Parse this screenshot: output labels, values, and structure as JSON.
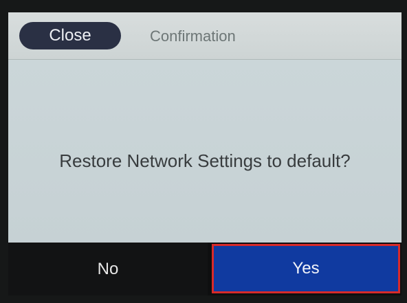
{
  "header": {
    "close_label": "Close",
    "title": "Confirmation"
  },
  "dialog": {
    "message": "Restore Network Settings to default?"
  },
  "buttons": {
    "no_label": "No",
    "yes_label": "Yes"
  },
  "colors": {
    "close_button_bg": "#2a3044",
    "yes_button_bg": "#103aa0",
    "highlight_border": "#d82a2a"
  }
}
